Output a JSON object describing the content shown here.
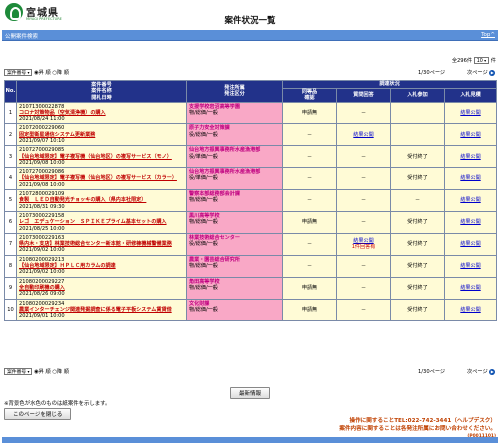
{
  "header": {
    "prefecture": "宮城県",
    "prefecture_sub": "MIYAGI PREFECTURE",
    "title": "案件状況一覧"
  },
  "bar": {
    "label": "公開案件検索",
    "top_link": "Top^"
  },
  "count": {
    "prefix": "全296件",
    "per_page": "10",
    "suffix": "件"
  },
  "controls": {
    "sort_select": "案件番号",
    "asc": "昇 順",
    "desc": "降 順",
    "page": "1/30ページ",
    "next": "次ページ"
  },
  "headers": {
    "no": "No.",
    "case": "案件番号\n案件名称\n開札日時",
    "org": "発注所属\n発注区分",
    "survey": "調達状況",
    "q1": "同等品\n確認",
    "q2": "質問回答",
    "q3": "入札参加",
    "q4": "入札見積"
  },
  "rows": [
    {
      "no": "1",
      "num": "21071300022878",
      "name": "コロナ対策物品（空気清浄機）の購入",
      "date": "2021/08/24 11:00",
      "org": "支援学校岩沼高等学園",
      "kind": "物/総価/一般",
      "q1": "申請無",
      "q2": "－",
      "q3": "",
      "q4": "結果公開"
    },
    {
      "no": "2",
      "num": "21072000229060",
      "name": "固定型衛星通信システム更新業務",
      "date": "2021/09/07 10:10",
      "org": "原子力安全対策課",
      "kind": "役/総価/一般",
      "q1": "－",
      "q2": "結果公開",
      "q3": "",
      "q4": "結果公開"
    },
    {
      "no": "3",
      "num": "21072700029085",
      "name": "【仙台地域限定】電子複写機（仙台地区）の複写サービス（モノ）",
      "date": "2021/09/08 10:00",
      "org": "仙台地方振興事務所水産漁港部",
      "kind": "役/単価/一般",
      "q1": "－",
      "q2": "－",
      "q3": "受付終了",
      "q4": "結果公開"
    },
    {
      "no": "4",
      "num": "21072700029086",
      "name": "【仙台地域限定】電子複写機（仙台地区）の複写サービス（カラー）",
      "date": "2021/09/08 10:00",
      "org": "仙台地方振興事務所水産漁港部",
      "kind": "役/単価/一般",
      "q1": "－",
      "q2": "－",
      "q3": "受付終了",
      "q4": "結果公開"
    },
    {
      "no": "5",
      "num": "21072800029109",
      "name": "食製　ＬＥＤ自動発光チョッキの購入（県内本社限定）",
      "date": "2021/08/31 09:30",
      "org": "警察本部総務部会計課",
      "kind": "物/総価/一般",
      "q1": "－",
      "q2": "－",
      "q3": "－",
      "q4": "結果公開"
    },
    {
      "no": "6",
      "num": "21073000229158",
      "name": "レゴ　エデュケーション　ＳＰＩＫＥプライム基本セットの購入",
      "date": "2021/08/25 10:00",
      "org": "黒川高等学校",
      "kind": "物/総価/一般",
      "q1": "申請無",
      "q2": "－",
      "q3": "受付終了",
      "q4": "結果公開"
    },
    {
      "no": "7",
      "num": "21073000229163",
      "name": "県内木・支店】林業技術総合センター新本館・研修棟機械警備業務",
      "date": "2021/09/02 10:00",
      "org": "林業技術総合センター",
      "kind": "役/総価/一般",
      "q1": "－",
      "q2": "結果公開",
      "q2b": "1件回答有",
      "q3": "受付終了",
      "q4": "結果公開"
    },
    {
      "no": "8",
      "num": "21080200029213",
      "name": "【仙台地域限定】ＨＰＬＣ用カラムの調達",
      "date": "2021/09/02 10:00",
      "org": "農業・園芸総合研究所",
      "kind": "物/総価/一般",
      "q1": "－",
      "q2": "－",
      "q3": "受付終了",
      "q4": "結果公開"
    },
    {
      "no": "9",
      "num": "21080200029227",
      "name": "全自動印刷機の購入",
      "date": "2021/08/26 09:00",
      "org": "角田高等学校",
      "kind": "物/総価/一般",
      "q1": "申請無",
      "q2": "－",
      "q3": "受付終了",
      "q4": "結果公開"
    },
    {
      "no": "10",
      "num": "21080200029234",
      "name": "農業インターチェンジ関連発掘調査に係る電子平板システム賃貸借",
      "date": "2021/09/01 10:00",
      "org": "文化財課",
      "kind": "物/総価/一般",
      "q1": "申請無",
      "q2": "－",
      "q3": "受付終了",
      "q4": "結果公開"
    }
  ],
  "bottom": {
    "newest": "最新情報",
    "note": "※背景色が水色のものは紙案件を示します。",
    "close": "このページを閉じる",
    "contact1": "操作に関することTEL:022-742-3441（ヘルプデスク）",
    "contact2": "案件内容に関することは各発注所属にお問い合わせください。",
    "code": "(P0011101)"
  }
}
